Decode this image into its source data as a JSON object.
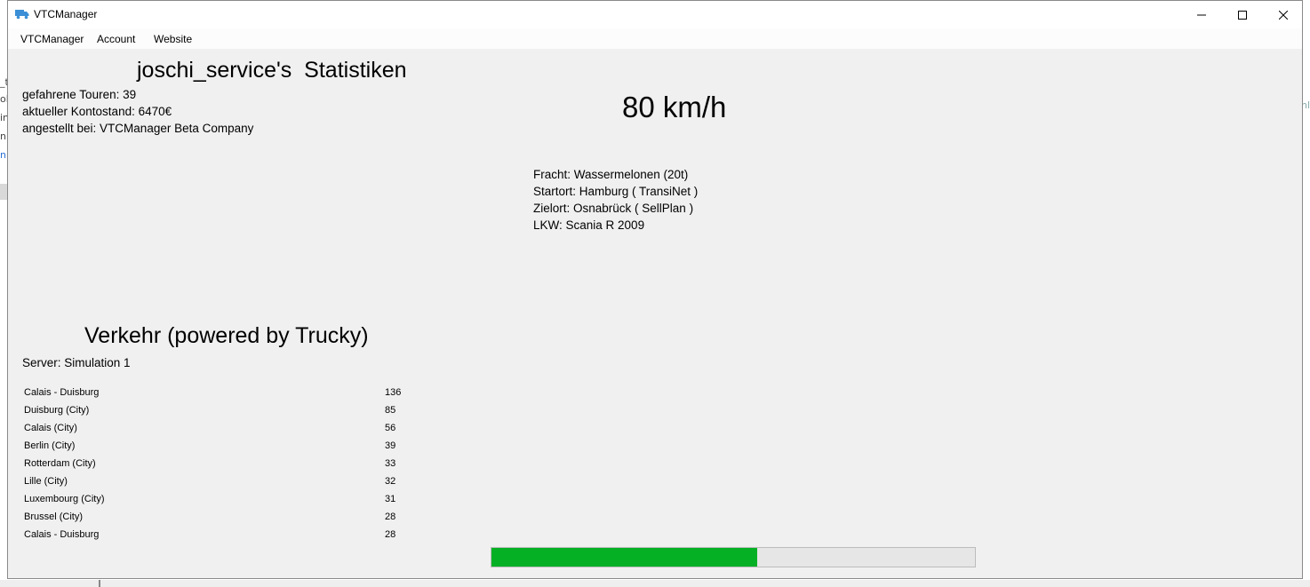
{
  "window": {
    "title": "VTCManager"
  },
  "menu": {
    "items": [
      "VTCManager",
      "Account",
      "Website"
    ]
  },
  "stats": {
    "title": "joschi_service's  Statistiken",
    "tours": "gefahrene Touren: 39",
    "balance": "aktueller Kontostand: 6470€",
    "employer": "angestellt bei: VTCManager Beta Company"
  },
  "speed": "80 km/h",
  "cargo": {
    "freight": "Fracht: Wassermelonen (20t)",
    "start": "Startort: Hamburg ( TransiNet )",
    "destination": "Zielort: Osnabrück ( SellPlan )",
    "truck": "LKW: Scania R 2009"
  },
  "traffic": {
    "title": "Verkehr (powered by Trucky)",
    "server": "Server: Simulation 1",
    "rows": [
      {
        "name": "Calais - Duisburg",
        "count": "136"
      },
      {
        "name": "Duisburg (City)",
        "count": "85"
      },
      {
        "name": "Calais (City)",
        "count": "56"
      },
      {
        "name": "Berlin (City)",
        "count": "39"
      },
      {
        "name": "Rotterdam (City)",
        "count": "33"
      },
      {
        "name": "Lille (City)",
        "count": "32"
      },
      {
        "name": "Luxembourg (City)",
        "count": "31"
      },
      {
        "name": "Brussel (City)",
        "count": "28"
      },
      {
        "name": "Calais - Duisburg",
        "count": "28"
      }
    ]
  },
  "progress": {
    "fraction": 0.55
  },
  "colors": {
    "progress_fill": "#06b025",
    "window_bg": "#f0f0f0",
    "icon_blue": "#3a8fd6"
  },
  "background_fragments": {
    "left": [
      "_t",
      "ole",
      "in",
      "n",
      "n"
    ],
    "right": "nl"
  }
}
